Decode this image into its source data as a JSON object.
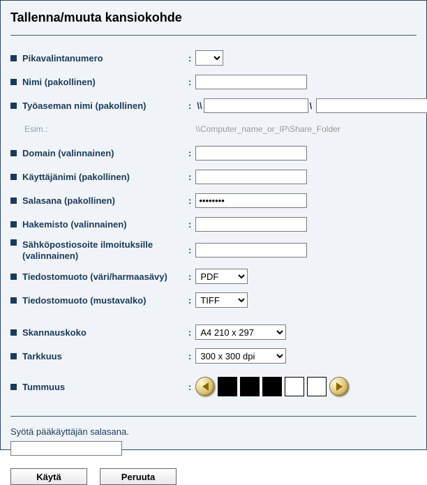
{
  "title": "Tallenna/muuta kansiokohde",
  "labels": {
    "quick_dial": "Pikavalintanumero",
    "name": "Nimi (pakollinen)",
    "hostname": "Työaseman nimi (pakollinen)",
    "example_label": "Esim.:",
    "example_value": "\\\\Computer_name_or_IP\\Share_Folder",
    "domain": "Domain (valinnainen)",
    "username": "Käyttäjänimi (pakollinen)",
    "password": "Salasana (pakollinen)",
    "directory": "Hakemisto (valinnainen)",
    "email": "Sähköpostiosoite ilmoituksille (valinnainen)",
    "fmt_color": "Tiedostomuoto (väri/harmaasävy)",
    "fmt_mono": "Tiedostomuoto (mustavalko)",
    "scan_size": "Skannauskoko",
    "resolution": "Tarkkuus",
    "darkness": "Tummuus"
  },
  "values": {
    "quick_dial": "",
    "name": "",
    "host_pre": "\\\\",
    "host_a": "",
    "host_sep": "\\",
    "host_b": "",
    "domain": "",
    "username": "",
    "password": "••••••••",
    "directory": "",
    "email": "",
    "fmt_color": "PDF",
    "fmt_mono": "TIFF",
    "scan_size": "A4 210 x 297",
    "resolution": "300 x 300 dpi"
  },
  "darkness_swatches": [
    "#000000",
    "#000000",
    "#000000",
    "#ffffff",
    "#ffffff"
  ],
  "footer": {
    "admin_label": "Syötä pääkäyttäjän salasana.",
    "apply": "Käytä",
    "cancel": "Peruuta"
  }
}
